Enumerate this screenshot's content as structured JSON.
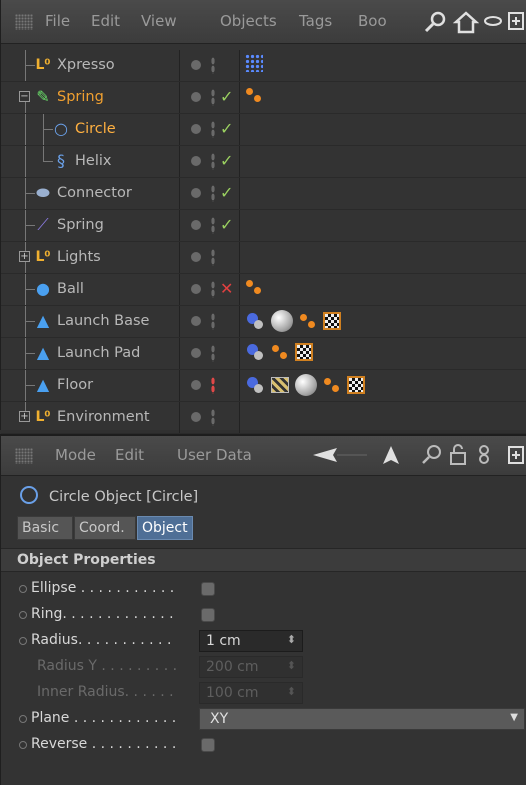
{
  "object_manager": {
    "menu": [
      "File",
      "Edit",
      "View",
      "Objects",
      "Tags",
      "Boo"
    ],
    "toolbar_icons": [
      "search-icon",
      "home-icon",
      "orbit-icon",
      "add-panel-icon"
    ],
    "objects": [
      {
        "name": "Xpresso",
        "icon": "null-icon",
        "depth": 0,
        "expander": false,
        "vis_dot": "gray",
        "status": "",
        "tags": [
          "xpresso"
        ]
      },
      {
        "name": "Spring",
        "icon": "spring-object-icon",
        "depth": 0,
        "expander": true,
        "vis_dot": "gray",
        "status": "✓",
        "state": "active",
        "tags": [
          "dots"
        ]
      },
      {
        "name": "Circle",
        "icon": "circle-icon",
        "depth": 1,
        "expander": false,
        "vis_dot": "gray",
        "status": "✓",
        "state": "selected",
        "tags": []
      },
      {
        "name": "Helix",
        "icon": "helix-icon",
        "depth": 1,
        "expander": false,
        "vis_dot": "gray",
        "status": "✓",
        "tags": []
      },
      {
        "name": "Connector",
        "icon": "connector-icon",
        "depth": 0,
        "expander": false,
        "vis_dot": "gray",
        "status": "✓",
        "tags": []
      },
      {
        "name": "Spring",
        "icon": "spring-icon",
        "depth": 0,
        "expander": false,
        "vis_dot": "gray",
        "status": "✓",
        "tags": []
      },
      {
        "name": "Lights",
        "icon": "null-icon",
        "depth": 0,
        "expander": true,
        "vis_dot": "gray",
        "status": "",
        "tags": []
      },
      {
        "name": "Ball",
        "icon": "sphere-icon",
        "depth": 0,
        "expander": false,
        "vis_dot": "gray",
        "status": "✕",
        "tags": [
          "dots"
        ]
      },
      {
        "name": "Launch Base",
        "icon": "polygon-icon",
        "depth": 0,
        "expander": false,
        "vis_dot": "gray",
        "status": "",
        "tags": [
          "material",
          "sphere",
          "dots",
          "checker"
        ]
      },
      {
        "name": "Launch Pad",
        "icon": "polygon-icon",
        "depth": 0,
        "expander": false,
        "vis_dot": "gray",
        "status": "",
        "tags": [
          "material",
          "dots",
          "checker"
        ]
      },
      {
        "name": "Floor",
        "icon": "polygon-icon",
        "depth": 0,
        "expander": false,
        "vis_dot": "red",
        "status": "",
        "tags": [
          "material",
          "clapper",
          "sphere",
          "dots",
          "checker"
        ]
      },
      {
        "name": "Environment",
        "icon": "null-icon",
        "depth": 0,
        "expander": true,
        "vis_dot": "gray",
        "status": "",
        "tags": []
      }
    ]
  },
  "attribute_manager": {
    "menu": [
      "Mode",
      "Edit",
      "User Data"
    ],
    "toolbar_icons": [
      "back-arrow-icon",
      "up-arrow-icon",
      "search-icon",
      "lock-icon",
      "link-icon",
      "add-panel-icon"
    ],
    "title": "Circle Object [Circle]",
    "tabs": [
      "Basic",
      "Coord.",
      "Object"
    ],
    "active_tab": "Object",
    "group": "Object Properties",
    "properties": [
      {
        "label": "Ellipse . . . . . . . . . . .",
        "type": "checkbox",
        "enabled": true
      },
      {
        "label": "Ring. . . . . . . . . . . . .",
        "type": "checkbox",
        "enabled": true
      },
      {
        "label": "Radius. . . . . . . . . . .",
        "type": "number",
        "value": "1 cm",
        "enabled": true
      },
      {
        "label": "Radius Y . . . . . . . . .",
        "type": "number",
        "value": "200 cm",
        "enabled": false
      },
      {
        "label": "Inner Radius. . . . . .",
        "type": "number",
        "value": "100 cm",
        "enabled": false
      },
      {
        "label": "Plane . . . . . . . . . . . .",
        "type": "select",
        "value": "XY",
        "enabled": true
      },
      {
        "label": "Reverse . . . . . . . . . .",
        "type": "checkbox",
        "enabled": true
      }
    ]
  }
}
